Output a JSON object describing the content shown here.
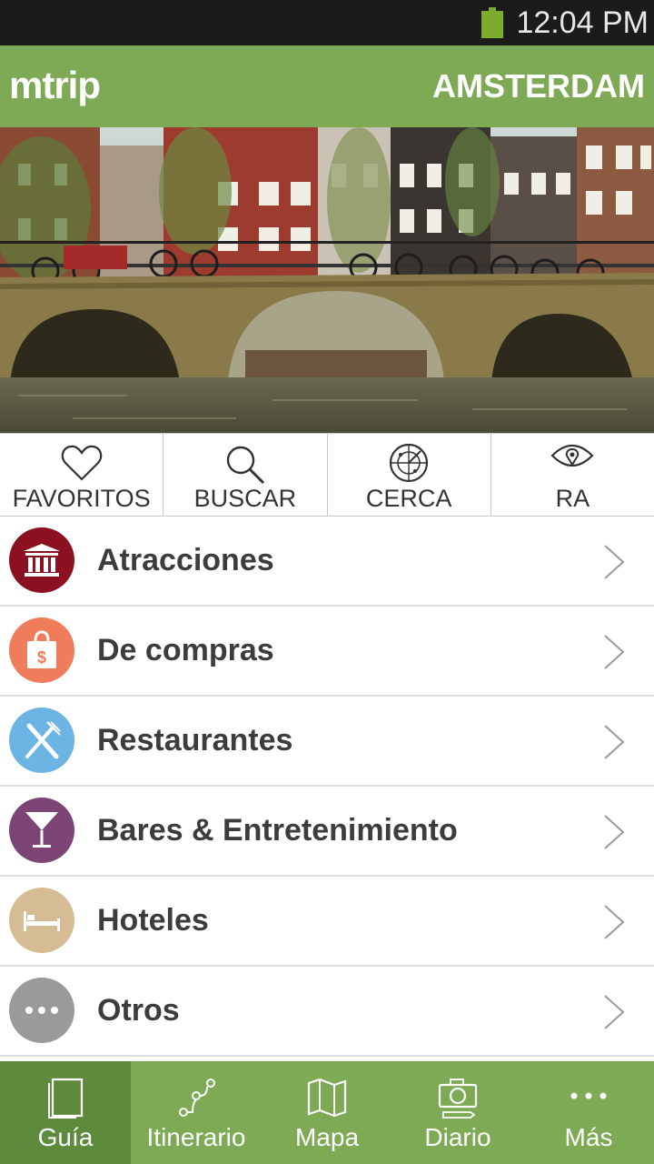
{
  "status_bar": {
    "time": "12:04 PM",
    "battery_color": "#7aab2a"
  },
  "header": {
    "logo": "mtrip",
    "city": "AMSTERDAM",
    "color": "#7eaa55"
  },
  "quick_actions": [
    {
      "label": "FAVORITOS",
      "icon": "heart-icon"
    },
    {
      "label": "BUSCAR",
      "icon": "search-icon"
    },
    {
      "label": "CERCA",
      "icon": "radar-icon"
    },
    {
      "label": "RA",
      "icon": "eye-icon"
    }
  ],
  "categories": [
    {
      "label": "Atracciones",
      "icon": "museum-icon",
      "color": "#8b1020"
    },
    {
      "label": "De compras",
      "icon": "shopping-bag-icon",
      "color": "#ef7c5a"
    },
    {
      "label": "Restaurantes",
      "icon": "fork-knife-icon",
      "color": "#6cb4e4"
    },
    {
      "label": "Bares & Entretenimiento",
      "icon": "cocktail-icon",
      "color": "#7d4576"
    },
    {
      "label": "Hoteles",
      "icon": "bed-icon",
      "color": "#d6bc94"
    },
    {
      "label": "Otros",
      "icon": "more-icon",
      "color": "#9a9a9a"
    }
  ],
  "tabs": [
    {
      "label": "Guía",
      "icon": "guide-book-icon",
      "active": true
    },
    {
      "label": "Itinerario",
      "icon": "route-icon",
      "active": false
    },
    {
      "label": "Mapa",
      "icon": "map-icon",
      "active": false
    },
    {
      "label": "Diario",
      "icon": "camera-icon",
      "active": false
    },
    {
      "label": "Más",
      "icon": "more-dots-icon",
      "active": false
    }
  ]
}
